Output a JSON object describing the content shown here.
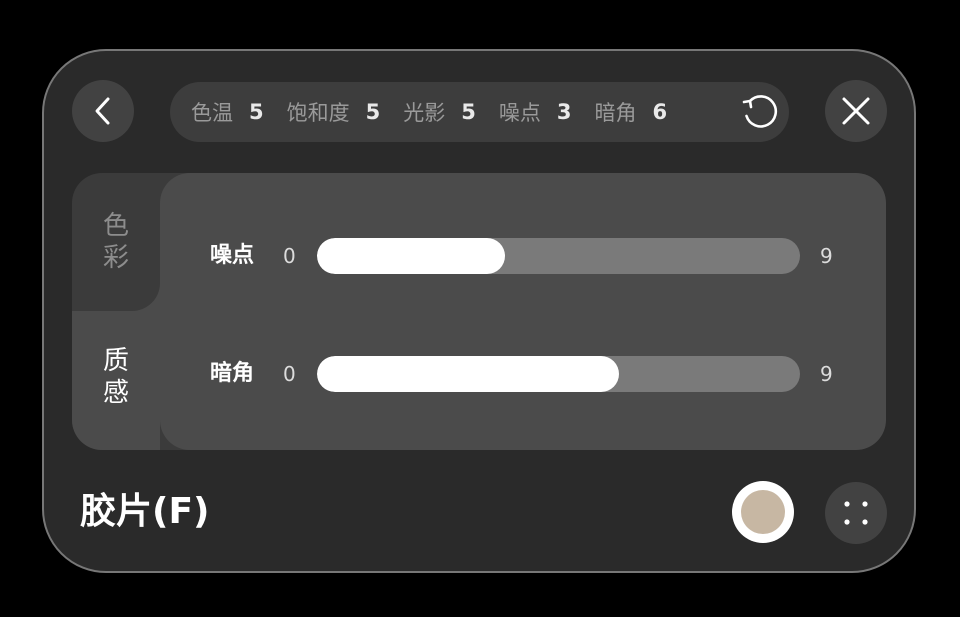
{
  "summary": {
    "items": [
      {
        "label": "色温",
        "value": "5"
      },
      {
        "label": "饱和度",
        "value": "5"
      },
      {
        "label": "光影",
        "value": "5"
      },
      {
        "label": "噪点",
        "value": "3"
      },
      {
        "label": "暗角",
        "value": "6"
      }
    ]
  },
  "tabs": [
    {
      "label": "色彩",
      "active": false
    },
    {
      "label": "质感",
      "active": true
    }
  ],
  "sliders": [
    {
      "label": "噪点",
      "min": "0",
      "max": "9",
      "value_fraction": 0.39
    },
    {
      "label": "暗角",
      "min": "0",
      "max": "9",
      "value_fraction": 0.625
    }
  ],
  "footer": {
    "title": "胶片(F)",
    "swatch_color": "#c7b7a3"
  },
  "icons": {
    "back": "chevron-left-icon",
    "close": "close-icon",
    "reset": "reset-icon",
    "grid": "grid-icon"
  },
  "colors": {
    "panel": "#2a2a2a",
    "main_panel": "#4b4b4b",
    "track": "#7a7a7a",
    "fill": "#ffffff"
  }
}
